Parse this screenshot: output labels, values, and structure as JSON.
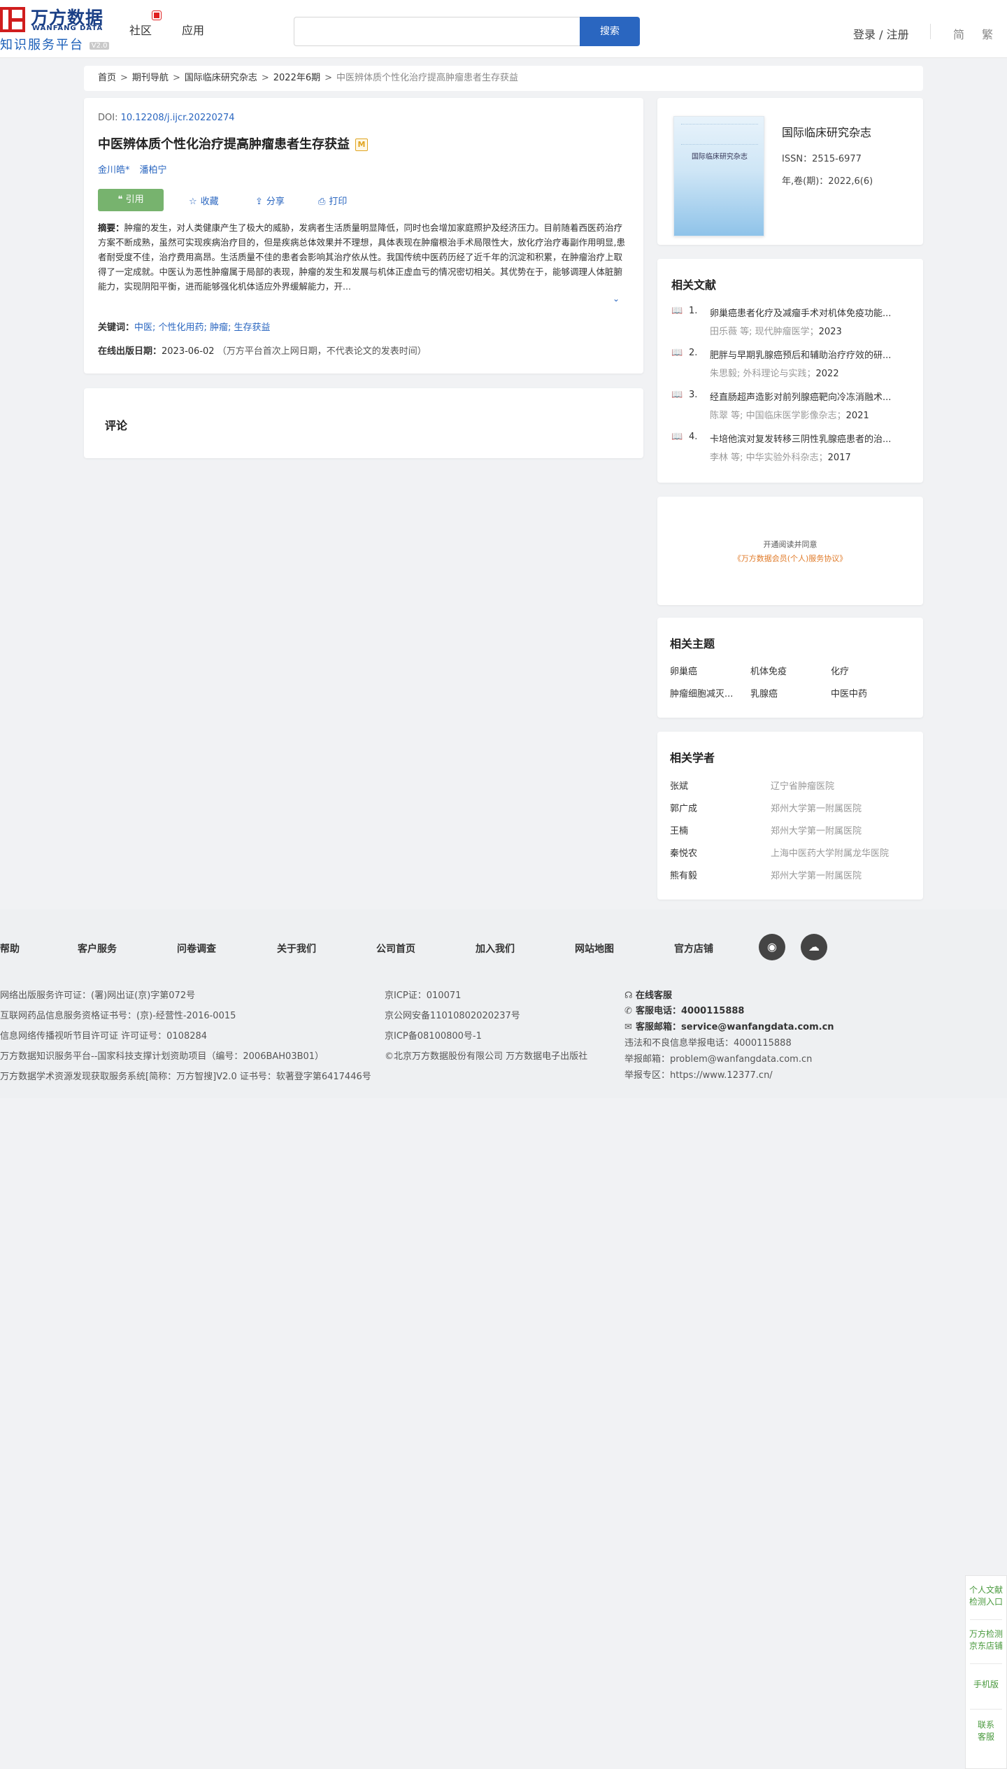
{
  "header": {
    "logo_cn": "万方数据",
    "logo_en": "WANFANG DATA",
    "logo_sub": "知识服务平台",
    "logo_version": "V2.0",
    "nav": [
      "社区",
      "应用"
    ],
    "search_placeholder": "",
    "search_button": "搜索",
    "login": "登录 / 注册",
    "lang_simplified": "简",
    "lang_traditional": "繁"
  },
  "breadcrumb": {
    "items": [
      "首页",
      "期刊导航",
      "国际临床研究杂志",
      "2022年6期"
    ],
    "separator": ">",
    "current": "中医辨体质个性化治疗提高肿瘤患者生存获益"
  },
  "article": {
    "doi_label": "DOI: ",
    "doi": "10.12208/j.ijcr.20220274",
    "title": "中医辨体质个性化治疗提高肿瘤患者生存获益",
    "badge": "M",
    "authors": [
      "金川皓*",
      "潘柏宁"
    ],
    "actions": {
      "cite": "引用",
      "favorite": "收藏",
      "share": "分享",
      "print": "打印"
    },
    "abstract_label": "摘要：",
    "abstract": "肿瘤的发生，对人类健康产生了极大的威胁，发病者生活质量明显降低，同时也会增加家庭照护及经济压力。目前随着西医药治疗方案不断成熟，虽然可实现疾病治疗目的，但是疾病总体效果并不理想，具体表现在肿瘤根治手术局限性大，放化疗治疗毒副作用明显,患者耐受度不佳，治疗费用高昂。生活质量不佳的患者会影响其治疗依从性。我国传统中医药历经了近千年的沉淀和积累，在肿瘤治疗上取得了一定成就。中医认为恶性肿瘤属于局部的表现，肿瘤的发生和发展与机体正虚血亏的情况密切相关。其优势在于，能够调理人体脏腑能力，实现阴阳平衡，进而能够强化机体适应外界缓解能力，开...",
    "keywords_label": "关键词：",
    "keywords": "中医; 个性化用药; 肿瘤; 生存获益",
    "pubdate_label": "在线出版日期：",
    "pubdate": "2023-06-02",
    "pubdate_note": "（万方平台首次上网日期，不代表论文的发表时间）"
  },
  "comment": {
    "title": "评论"
  },
  "journal": {
    "cover_title": "国际临床研究杂志",
    "name": "国际临床研究杂志",
    "issn": "ISSN：2515-6977",
    "volume": "年,卷(期)：2022,6(6)"
  },
  "related": {
    "title": "相关文献",
    "items": [
      {
        "num": "1.",
        "title": "卵巢癌患者化疗及减瘤手术对机体免疫功能...",
        "authors": "田乐薇  等; 现代肿瘤医学；",
        "year": "2023"
      },
      {
        "num": "2.",
        "title": "肥胖与早期乳腺癌预后和辅助治疗疗效的研...",
        "authors": "朱思毅; 外科理论与实践；",
        "year": "2022"
      },
      {
        "num": "3.",
        "title": "经直肠超声造影对前列腺癌靶向冷冻消融术...",
        "authors": "陈翠  等; 中国临床医学影像杂志；",
        "year": "2021"
      },
      {
        "num": "4.",
        "title": "卡培他滨对复发转移三阴性乳腺癌患者的治...",
        "authors": "李林  等; 中华实验外科杂志；",
        "year": "2017"
      }
    ]
  },
  "open_read": {
    "line1": "开通阅读并同意",
    "line2": "《万方数据会员(个人)服务协议》"
  },
  "topics": {
    "title": "相关主题",
    "items": [
      "卵巢癌",
      "机体免疫",
      "化疗",
      "肿瘤细胞减灭...",
      "乳腺癌",
      "中医中药"
    ]
  },
  "scholars": {
    "title": "相关学者",
    "items": [
      {
        "name": "张斌",
        "org": "辽宁省肿瘤医院"
      },
      {
        "name": "郭广成",
        "org": "郑州大学第一附属医院"
      },
      {
        "name": "王楠",
        "org": "郑州大学第一附属医院"
      },
      {
        "name": "秦悦农",
        "org": "上海中医药大学附属龙华医院"
      },
      {
        "name": "熊有毅",
        "org": "郑州大学第一附属医院"
      }
    ]
  },
  "footer": {
    "nav": [
      "帮助",
      "客户服务",
      "问卷调查",
      "关于我们",
      "公司首页",
      "加入我们",
      "网站地图",
      "官方店铺"
    ],
    "col1": [
      "网络出版服务许可证：(署)网出证(京)字第072号",
      "互联网药品信息服务资格证书号：(京)-经营性-2016-0015",
      "信息网络传播视听节目许可证 许可证号：0108284",
      "万方数据知识服务平台--国家科技支撑计划资助项目（编号：2006BAH03B01）",
      "万方数据学术资源发现获取服务系统[简称：万方智搜]V2.0 证书号：软著登字第6417446号"
    ],
    "col2": [
      "京ICP证：010071",
      "京公网安备11010802020237号",
      "京ICP备08100800号-1",
      "©北京万方数据股份有限公司 万方数据电子出版社"
    ],
    "online_service": "在线客服",
    "phone_label": "客服电话：",
    "phone": "4000115888",
    "email_label": "客服邮箱：",
    "email": "service@wanfangdata.com.cn",
    "report_phone": "违法和不良信息举报电话：4000115888",
    "report_email": "举报邮箱：problem@wanfangdata.com.cn",
    "report_zone": "举报专区：https://www.12377.cn/"
  },
  "side": {
    "item1": "个人文献检测入口",
    "item2": "万方检测京东店铺",
    "item3": "手机版",
    "item4": "联系客服"
  }
}
